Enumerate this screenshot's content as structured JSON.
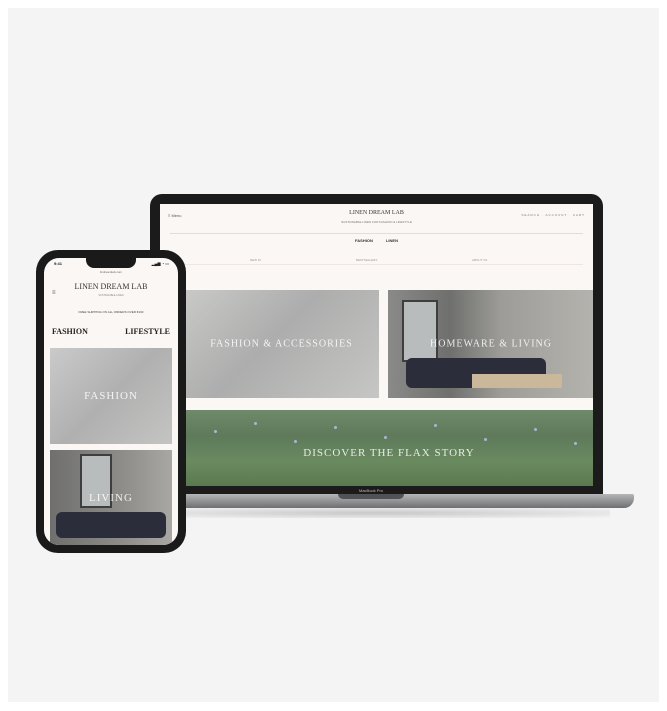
{
  "laptop": {
    "brand": "MacBook Pro",
    "site": {
      "menu": "≡ Menu",
      "logo": "LINEN DREAM LAB",
      "tagline": "SUSTAINABLE LINEN FOR FASHION & LIFESTYLE",
      "utility": "SEARCH · ACCOUNT · CART",
      "nav": [
        "FASHION",
        "LINEN"
      ],
      "subnav": [
        "NEW IN",
        "BESTSELLERS",
        "ABOUT US"
      ],
      "tiles": [
        {
          "label": "FASHION & ACCESSORIES"
        },
        {
          "label": "HOMEWARE & LIVING"
        },
        {
          "label": "DISCOVER THE FLAX STORY"
        }
      ]
    }
  },
  "phone": {
    "status_time": "9:41",
    "status_icons": "▂▄▆ ◔ ▭",
    "url": "lindreamlab.com",
    "menu": "≡",
    "logo": "LINEN DREAM LAB",
    "tagline": "SUSTAINABLE LINEN",
    "promo": "FREE SHIPPING ON ALL ORDERS OVER €100",
    "nav": [
      "FASHION",
      "LIFESTYLE"
    ],
    "tiles": [
      {
        "label": "FASHION"
      },
      {
        "label": "LIVING"
      }
    ]
  }
}
